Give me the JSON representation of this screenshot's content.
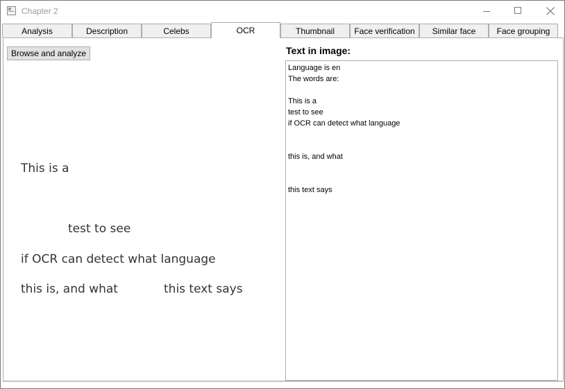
{
  "window": {
    "title": "Chapter 2"
  },
  "tabs": [
    {
      "label": "Analysis"
    },
    {
      "label": "Description"
    },
    {
      "label": "Celebs"
    },
    {
      "label": "OCR",
      "selected": true
    },
    {
      "label": "Thumbnail"
    },
    {
      "label": "Face verification"
    },
    {
      "label": "Similar face"
    },
    {
      "label": "Face grouping"
    }
  ],
  "ocr": {
    "browse_button_label": "Browse and analyze",
    "image_lines": [
      "This is a",
      "test to see",
      "if OCR can detect what language",
      "this is, and what",
      "this text says"
    ],
    "result_label": "Text in image:",
    "result_text": "Language is en\nThe words are:\n\nThis is a\ntest to see\nif OCR can detect what language\n\n\nthis is, and what\n\n\nthis text says"
  },
  "icons": {
    "app": "window-icon",
    "minimize": "minimize-icon",
    "maximize": "maximize-icon",
    "close": "close-icon"
  }
}
